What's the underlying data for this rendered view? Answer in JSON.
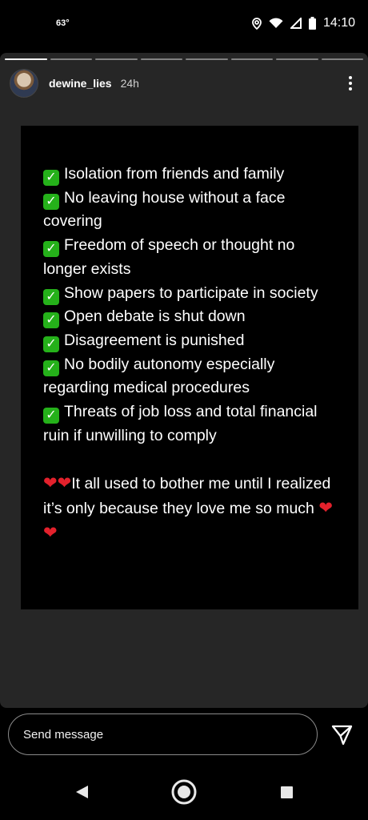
{
  "status_bar": {
    "temperature": "63°",
    "time": "14:10"
  },
  "story": {
    "progress": [
      1,
      0,
      0,
      0,
      0,
      0,
      0,
      0
    ],
    "username": "dewine_lies",
    "timestamp": "24h",
    "list_items": [
      "Isolation from friends and family",
      "No leaving house without a face covering",
      "Freedom of speech or thought no longer exists",
      "Show papers to participate in society",
      "Open debate is shut down",
      "Disagreement is punished",
      "No bodily autonomy especially regarding medical procedures",
      "Threats of job loss and total financial ruin if unwilling to comply"
    ],
    "closing_text": "It all used to bother me until I realized it’s only because they love me so much"
  },
  "message": {
    "placeholder": "Send message"
  },
  "colors": {
    "check": "#25b11a",
    "heart": "#e3212c",
    "surface": "#262626"
  },
  "icons": [
    "location-icon",
    "wifi-icon",
    "signal-icon",
    "battery-icon",
    "more-options-icon",
    "send-icon",
    "back-icon",
    "home-icon",
    "recents-icon"
  ]
}
